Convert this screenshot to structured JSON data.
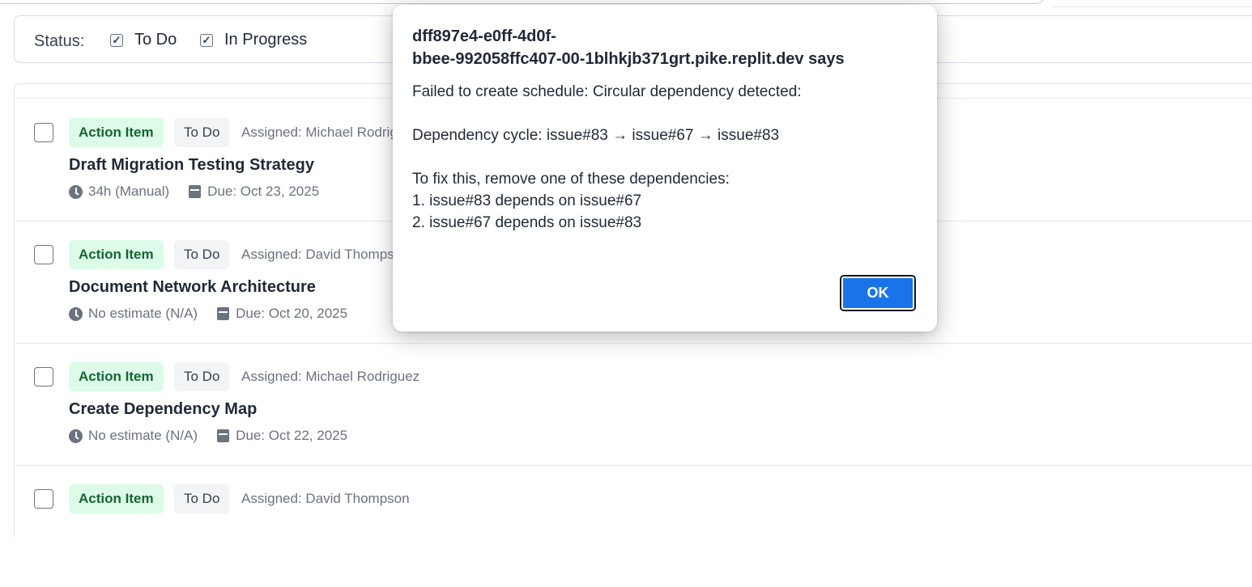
{
  "filters": {
    "label": "Status:",
    "options": [
      {
        "label": "To Do",
        "checked": true
      },
      {
        "label": "In Progress",
        "checked": true
      }
    ]
  },
  "tasks": [
    {
      "type": "Action Item",
      "status": "To Do",
      "assigned": "Assigned: Michael Rodriguez",
      "title": "Draft Migration Testing Strategy",
      "estimate": "34h (Manual)",
      "due": "Due: Oct 23, 2025"
    },
    {
      "type": "Action Item",
      "status": "To Do",
      "assigned": "Assigned: David Thompson",
      "title": "Document Network Architecture",
      "estimate": "No estimate (N/A)",
      "due": "Due: Oct 20, 2025"
    },
    {
      "type": "Action Item",
      "status": "To Do",
      "assigned": "Assigned: Michael Rodriguez",
      "title": "Create Dependency Map",
      "estimate": "No estimate (N/A)",
      "due": "Due: Oct 22, 2025"
    },
    {
      "type": "Action Item",
      "status": "To Do",
      "assigned": "Assigned: David Thompson"
    }
  ],
  "dialog": {
    "title_line1": "dff897e4-e0ff-4d0f-",
    "title_line2": "bbee-992058ffc407-00-1blhkjb371grt.pike.replit.dev says",
    "message_lines": [
      "Failed to create schedule: Circular dependency detected:",
      "",
      "Dependency cycle: issue#83 → issue#67 → issue#83",
      "",
      "To fix this, remove one of these dependencies:",
      "1. issue#83 depends on issue#67",
      "2. issue#67 depends on issue#83"
    ],
    "ok_label": "OK"
  },
  "colors": {
    "badge_type_bg": "#dcfce7",
    "badge_type_text": "#166534",
    "ok_button": "#1a73e8"
  }
}
